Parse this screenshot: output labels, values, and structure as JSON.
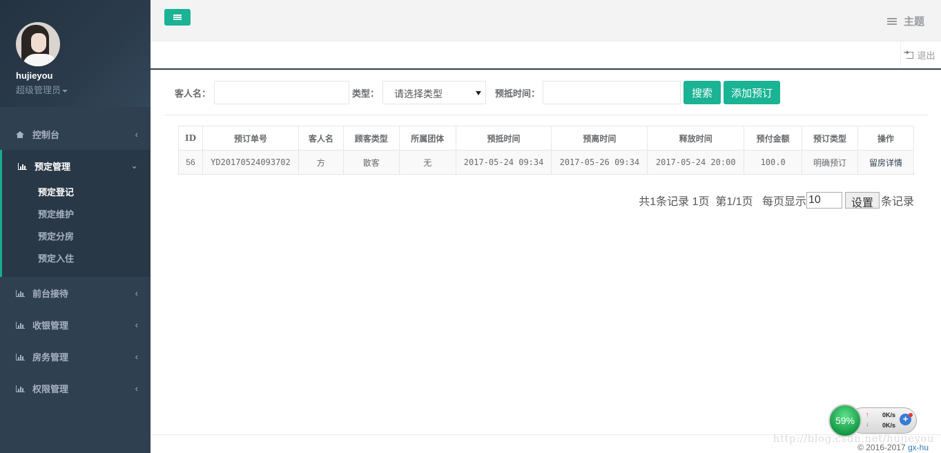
{
  "user": {
    "name": "hujieyou",
    "role": "超级管理员"
  },
  "nav": {
    "dashboard": "控制台",
    "booking": {
      "label": "预定管理",
      "items": [
        "预定登记",
        "预定维护",
        "预定分房",
        "预定入住"
      ]
    },
    "front_desk": "前台接待",
    "cashier": "收银管理",
    "housekeeping": "房务管理",
    "permissions": "权限管理"
  },
  "topbar": {
    "theme": "主题",
    "logout": "退出"
  },
  "search": {
    "guest_label": "客人名：",
    "guest_value": "",
    "type_label": "类型：",
    "type_selected": "请选择类型",
    "time_label": "预抵时间：",
    "time_value": "",
    "search_btn": "搜索",
    "add_btn": "添加预订"
  },
  "table": {
    "headers": [
      "ID",
      "预订单号",
      "客人名",
      "顾客类型",
      "所属团体",
      "预抵时间",
      "预离时间",
      "释放时间",
      "预付金额",
      "预订类型",
      "操作"
    ],
    "rows": [
      [
        "56",
        "YD20170524093702",
        "方",
        "散客",
        "无",
        "2017-05-24 09:34",
        "2017-05-26 09:34",
        "2017-05-24 20:00",
        "100.0",
        "明确预订",
        "留房详情"
      ]
    ]
  },
  "pager": {
    "summary": "共1条记录 1页  第1/1页   每页显示",
    "page_size": "10",
    "set_btn": "设置",
    "suffix": "条记录"
  },
  "widget": {
    "percent": "59%",
    "up": "0K/s",
    "down": "0K/s"
  },
  "footer": {
    "copy": "© 2016-2017 ",
    "author": "gx-hu",
    "watermark": "http://blog.csdn.net/hujieyou"
  },
  "colors": {
    "accent": "#1ab394",
    "sidebar": "#2f4050"
  }
}
